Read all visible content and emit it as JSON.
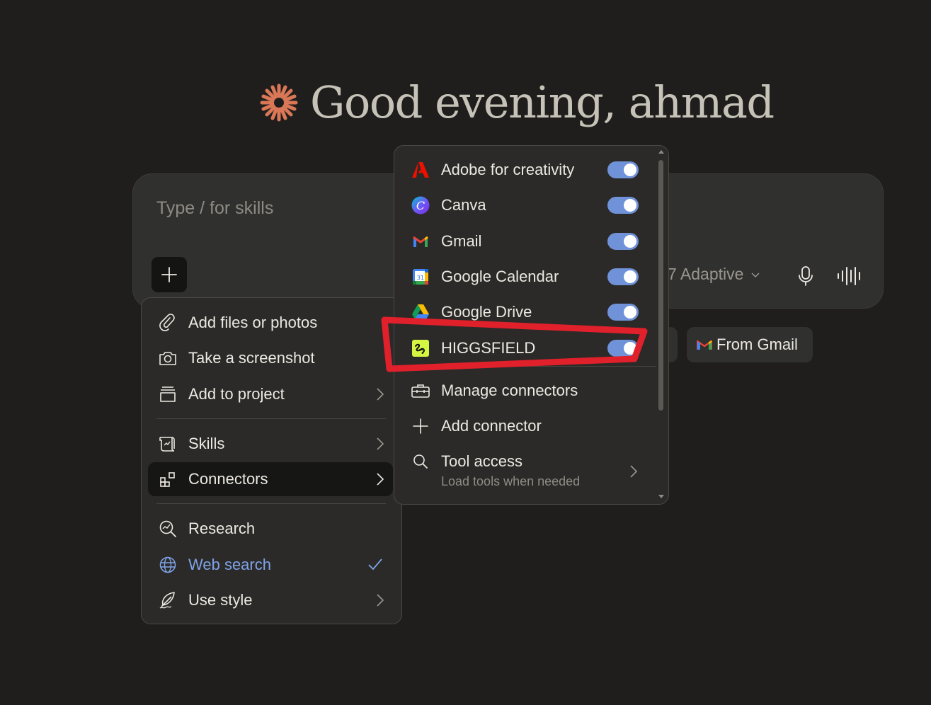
{
  "greeting": {
    "text": "Good evening, ahmad"
  },
  "composer": {
    "placeholder": "Type / for skills",
    "model_label": "7 Adaptive"
  },
  "suggestion_chip": {
    "label": "From Gmail"
  },
  "plus_menu": {
    "items": [
      {
        "label": "Add files or photos",
        "icon": "paperclip-icon"
      },
      {
        "label": "Take a screenshot",
        "icon": "camera-icon"
      },
      {
        "label": "Add to project",
        "icon": "project-box-icon",
        "submenu": true
      },
      {
        "label": "Skills",
        "icon": "scroll-icon",
        "submenu": true
      },
      {
        "label": "Connectors",
        "icon": "connectors-icon",
        "submenu": true,
        "active": true
      },
      {
        "label": "Research",
        "icon": "research-icon"
      },
      {
        "label": "Web search",
        "icon": "globe-icon",
        "checked": true
      },
      {
        "label": "Use style",
        "icon": "feather-icon",
        "submenu": true
      }
    ]
  },
  "connectors_menu": {
    "connectors": [
      {
        "label": "Adobe for creativity",
        "icon": "adobe-icon",
        "enabled": true
      },
      {
        "label": "Canva",
        "icon": "canva-icon",
        "enabled": true
      },
      {
        "label": "Gmail",
        "icon": "gmail-icon",
        "enabled": true
      },
      {
        "label": "Google Calendar",
        "icon": "google-calendar-icon",
        "enabled": true
      },
      {
        "label": "Google Drive",
        "icon": "google-drive-icon",
        "enabled": true
      },
      {
        "label": "HIGGSFIELD",
        "icon": "higgsfield-icon",
        "enabled": true
      }
    ],
    "actions": [
      {
        "label": "Manage connectors",
        "icon": "toolbox-icon"
      },
      {
        "label": "Add connector",
        "icon": "plus-icon"
      }
    ],
    "tool_access": {
      "label": "Tool access",
      "sublabel": "Load tools when needed",
      "icon": "search-icon"
    }
  },
  "colors": {
    "background": "#1f1e1d",
    "panel": "#2b2a28",
    "toggle_on": "#6f92d8",
    "accent_brand": "#d97757",
    "annotation": "#e0202a",
    "web_search_active": "#7ea3e6"
  }
}
